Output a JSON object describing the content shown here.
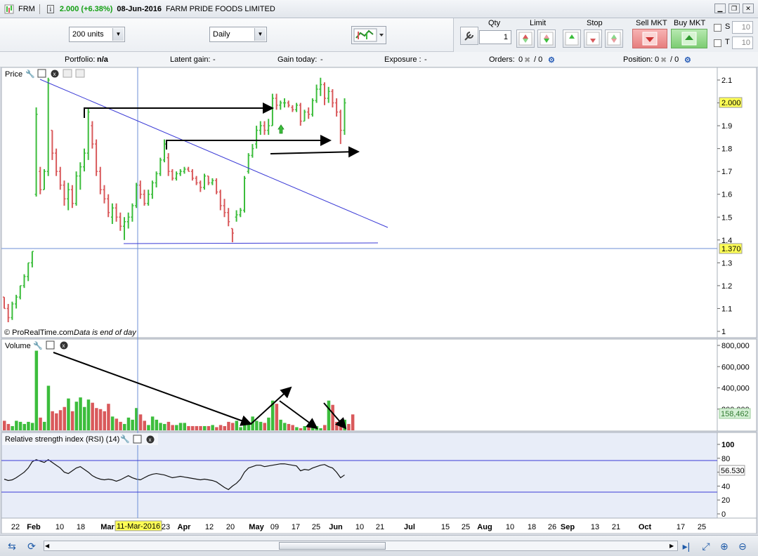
{
  "titlebar": {
    "symbol": "FRM",
    "info": "i",
    "price": "2.000 (+6.38%)",
    "date": "08-Jun-2016",
    "company": "FARM PRIDE FOODS LIMITED"
  },
  "toolbar": {
    "units": "200 units",
    "period": "Daily",
    "qty_label": "Qty",
    "qty_value": "1",
    "limit_label": "Limit",
    "stop_label": "Stop",
    "sell_label": "Sell MKT",
    "buy_label": "Buy MKT",
    "s_label": "S",
    "s_value": "10",
    "t_label": "T",
    "t_value": "10"
  },
  "infobar": {
    "portfolio_label": "Portfolio:",
    "portfolio_value": "n/a",
    "latent_label": "Latent gain:",
    "latent_value": "-",
    "gain_label": "Gain today:",
    "gain_value": "-",
    "exposure_label": "Exposure :",
    "exposure_value": "-",
    "orders_label": "Orders:",
    "orders_a": "0",
    "orders_b": "/ 0",
    "position_label": "Position:",
    "position_a": "0",
    "position_b": "/ 0"
  },
  "price_panel": {
    "title": "Price",
    "watermark": "© ProRealTime.com",
    "note": "Data is end of day",
    "current_price": "2.000",
    "crosshair_price": "1.370",
    "yticks": [
      "2.1",
      "2",
      "1.9",
      "1.8",
      "1.7",
      "1.6",
      "1.5",
      "1.4",
      "1.3",
      "1.2",
      "1.1",
      "1"
    ]
  },
  "volume_panel": {
    "title": "Volume",
    "current": "158,462",
    "yticks": [
      "800,000",
      "600,000",
      "400,000",
      "200,000"
    ]
  },
  "rsi_panel": {
    "title": "Relative strength index (RSI) (14)",
    "current": "56.530",
    "yticks": [
      "100",
      "80",
      "60",
      "40",
      "20",
      "0"
    ]
  },
  "xaxis": {
    "labels": [
      {
        "t": "22",
        "b": false
      },
      {
        "t": "Feb",
        "b": true
      },
      {
        "t": "10",
        "b": false
      },
      {
        "t": "18",
        "b": false
      },
      {
        "t": "Mar",
        "b": true
      },
      {
        "t": "23",
        "b": false
      },
      {
        "t": "Apr",
        "b": true
      },
      {
        "t": "12",
        "b": false
      },
      {
        "t": "20",
        "b": false
      },
      {
        "t": "May",
        "b": true
      },
      {
        "t": "09",
        "b": false
      },
      {
        "t": "17",
        "b": false
      },
      {
        "t": "25",
        "b": false
      },
      {
        "t": "Jun",
        "b": true
      },
      {
        "t": "10",
        "b": false
      },
      {
        "t": "21",
        "b": false
      },
      {
        "t": "Jul",
        "b": true
      },
      {
        "t": "15",
        "b": false
      },
      {
        "t": "25",
        "b": false
      },
      {
        "t": "Aug",
        "b": true
      },
      {
        "t": "10",
        "b": false
      },
      {
        "t": "18",
        "b": false
      },
      {
        "t": "26",
        "b": false
      },
      {
        "t": "Sep",
        "b": true
      },
      {
        "t": "13",
        "b": false
      },
      {
        "t": "21",
        "b": false
      },
      {
        "t": "Oct",
        "b": true
      },
      {
        "t": "17",
        "b": false
      },
      {
        "t": "25",
        "b": false
      }
    ],
    "crosshair_date": "11-Mar-2016"
  },
  "colors": {
    "up": "#3cbd3c",
    "down": "#d9595b",
    "trendline": "#3a3ad6",
    "panel_bg": "#ffffff",
    "rsi_bg": "#e8edf8",
    "current_price_bg": "#ffff55",
    "volume_label_bg": "#d6f0d6"
  },
  "chart_data": {
    "type": "ohlc",
    "title": "",
    "xlabel": "",
    "ylabel": "",
    "ylim": [
      1.0,
      2.15
    ],
    "price_bars": [
      {
        "o": 1.15,
        "h": 1.15,
        "l": 1.1,
        "c": 1.1
      },
      {
        "o": 1.1,
        "h": 1.12,
        "l": 1.04,
        "c": 1.06
      },
      {
        "o": 1.06,
        "h": 1.13,
        "l": 1.05,
        "c": 1.12
      },
      {
        "o": 1.12,
        "h": 1.16,
        "l": 1.1,
        "c": 1.15
      },
      {
        "o": 1.15,
        "h": 1.2,
        "l": 1.14,
        "c": 1.2
      },
      {
        "o": 1.2,
        "h": 1.25,
        "l": 1.19,
        "c": 1.24
      },
      {
        "o": 1.24,
        "h": 1.3,
        "l": 1.22,
        "c": 1.3
      },
      {
        "o": 1.3,
        "h": 1.35,
        "l": 1.28,
        "c": 1.35
      },
      {
        "o": 1.6,
        "h": 1.98,
        "l": 1.59,
        "c": 1.95
      },
      {
        "o": 1.7,
        "h": 1.72,
        "l": 1.6,
        "c": 1.62
      },
      {
        "o": 1.62,
        "h": 1.71,
        "l": 1.62,
        "c": 1.7
      },
      {
        "o": 1.7,
        "h": 2.11,
        "l": 1.68,
        "c": 2.1
      },
      {
        "o": 1.88,
        "h": 1.88,
        "l": 1.75,
        "c": 1.78
      },
      {
        "o": 1.78,
        "h": 1.8,
        "l": 1.68,
        "c": 1.7
      },
      {
        "o": 1.7,
        "h": 1.72,
        "l": 1.62,
        "c": 1.64
      },
      {
        "o": 1.64,
        "h": 1.66,
        "l": 1.55,
        "c": 1.58
      },
      {
        "o": 1.58,
        "h": 1.65,
        "l": 1.53,
        "c": 1.62
      },
      {
        "o": 1.62,
        "h": 1.64,
        "l": 1.54,
        "c": 1.56
      },
      {
        "o": 1.56,
        "h": 1.7,
        "l": 1.55,
        "c": 1.68
      },
      {
        "o": 1.68,
        "h": 1.74,
        "l": 1.62,
        "c": 1.72
      },
      {
        "o": 1.72,
        "h": 1.8,
        "l": 1.7,
        "c": 1.78
      },
      {
        "o": 1.78,
        "h": 1.98,
        "l": 1.75,
        "c": 1.96
      },
      {
        "o": 1.9,
        "h": 1.92,
        "l": 1.8,
        "c": 1.82
      },
      {
        "o": 1.82,
        "h": 1.84,
        "l": 1.68,
        "c": 1.7
      },
      {
        "o": 1.7,
        "h": 1.72,
        "l": 1.6,
        "c": 1.62
      },
      {
        "o": 1.62,
        "h": 1.64,
        "l": 1.56,
        "c": 1.58
      },
      {
        "o": 1.58,
        "h": 1.6,
        "l": 1.5,
        "c": 1.52
      },
      {
        "o": 1.5,
        "h": 1.56,
        "l": 1.47,
        "c": 1.54
      },
      {
        "o": 1.54,
        "h": 1.56,
        "l": 1.48,
        "c": 1.5
      },
      {
        "o": 1.5,
        "h": 1.52,
        "l": 1.44,
        "c": 1.46
      },
      {
        "o": 1.46,
        "h": 1.5,
        "l": 1.4,
        "c": 1.48
      },
      {
        "o": 1.48,
        "h": 1.52,
        "l": 1.45,
        "c": 1.5
      },
      {
        "o": 1.5,
        "h": 1.56,
        "l": 1.48,
        "c": 1.55
      },
      {
        "o": 1.55,
        "h": 1.65,
        "l": 1.54,
        "c": 1.64
      },
      {
        "o": 1.64,
        "h": 1.66,
        "l": 1.58,
        "c": 1.6
      },
      {
        "o": 1.6,
        "h": 1.62,
        "l": 1.55,
        "c": 1.56
      },
      {
        "o": 1.56,
        "h": 1.62,
        "l": 1.55,
        "c": 1.6
      },
      {
        "o": 1.6,
        "h": 1.66,
        "l": 1.58,
        "c": 1.65
      },
      {
        "o": 1.65,
        "h": 1.7,
        "l": 1.63,
        "c": 1.69
      },
      {
        "o": 1.69,
        "h": 1.76,
        "l": 1.68,
        "c": 1.75
      },
      {
        "o": 1.75,
        "h": 1.84,
        "l": 1.74,
        "c": 1.82
      },
      {
        "o": 1.76,
        "h": 1.78,
        "l": 1.68,
        "c": 1.7
      },
      {
        "o": 1.7,
        "h": 1.71,
        "l": 1.66,
        "c": 1.67
      },
      {
        "o": 1.67,
        "h": 1.7,
        "l": 1.66,
        "c": 1.69
      },
      {
        "o": 1.69,
        "h": 1.71,
        "l": 1.68,
        "c": 1.7
      },
      {
        "o": 1.7,
        "h": 1.72,
        "l": 1.69,
        "c": 1.71
      },
      {
        "o": 1.71,
        "h": 1.72,
        "l": 1.7,
        "c": 1.7
      },
      {
        "o": 1.7,
        "h": 1.71,
        "l": 1.66,
        "c": 1.67
      },
      {
        "o": 1.67,
        "h": 1.68,
        "l": 1.64,
        "c": 1.65
      },
      {
        "o": 1.65,
        "h": 1.66,
        "l": 1.61,
        "c": 1.63
      },
      {
        "o": 1.63,
        "h": 1.69,
        "l": 1.62,
        "c": 1.68
      },
      {
        "o": 1.68,
        "h": 1.68,
        "l": 1.64,
        "c": 1.65
      },
      {
        "o": 1.65,
        "h": 1.67,
        "l": 1.64,
        "c": 1.66
      },
      {
        "o": 1.66,
        "h": 1.67,
        "l": 1.6,
        "c": 1.61
      },
      {
        "o": 1.61,
        "h": 1.62,
        "l": 1.53,
        "c": 1.55
      },
      {
        "o": 1.55,
        "h": 1.58,
        "l": 1.5,
        "c": 1.52
      },
      {
        "o": 1.52,
        "h": 1.54,
        "l": 1.46,
        "c": 1.48
      },
      {
        "o": 1.45,
        "h": 1.45,
        "l": 1.39,
        "c": 1.43
      },
      {
        "o": 1.5,
        "h": 1.53,
        "l": 1.48,
        "c": 1.51
      },
      {
        "o": 1.51,
        "h": 1.54,
        "l": 1.5,
        "c": 1.53
      },
      {
        "o": 1.53,
        "h": 1.68,
        "l": 1.52,
        "c": 1.67
      },
      {
        "o": 1.7,
        "h": 1.78,
        "l": 1.69,
        "c": 1.77
      },
      {
        "o": 1.77,
        "h": 1.82,
        "l": 1.76,
        "c": 1.8
      },
      {
        "o": 1.82,
        "h": 1.9,
        "l": 1.8,
        "c": 1.88
      },
      {
        "o": 1.88,
        "h": 1.92,
        "l": 1.86,
        "c": 1.9
      },
      {
        "o": 1.9,
        "h": 1.92,
        "l": 1.86,
        "c": 1.88
      },
      {
        "o": 1.88,
        "h": 1.93,
        "l": 1.86,
        "c": 1.9
      },
      {
        "o": 1.9,
        "h": 2.04,
        "l": 1.9,
        "c": 2.02
      },
      {
        "o": 2.02,
        "h": 2.04,
        "l": 1.97,
        "c": 1.99
      },
      {
        "o": 1.99,
        "h": 2.01,
        "l": 1.97,
        "c": 2.0
      },
      {
        "o": 2.0,
        "h": 2.02,
        "l": 1.98,
        "c": 2.0
      },
      {
        "o": 2.0,
        "h": 2.01,
        "l": 1.98,
        "c": 1.99
      },
      {
        "o": 1.98,
        "h": 1.99,
        "l": 1.96,
        "c": 1.97
      },
      {
        "o": 1.97,
        "h": 2.0,
        "l": 1.96,
        "c": 1.99
      },
      {
        "o": 1.99,
        "h": 2.0,
        "l": 1.9,
        "c": 1.92
      },
      {
        "o": 1.92,
        "h": 1.97,
        "l": 1.92,
        "c": 1.96
      },
      {
        "o": 1.96,
        "h": 1.98,
        "l": 1.93,
        "c": 1.95
      },
      {
        "o": 1.95,
        "h": 2.02,
        "l": 1.94,
        "c": 2.01
      },
      {
        "o": 2.01,
        "h": 2.08,
        "l": 2.0,
        "c": 2.06
      },
      {
        "o": 2.06,
        "h": 2.11,
        "l": 2.03,
        "c": 2.08
      },
      {
        "o": 2.08,
        "h": 2.09,
        "l": 1.99,
        "c": 2.02
      },
      {
        "o": 2.02,
        "h": 2.07,
        "l": 2.0,
        "c": 2.05
      },
      {
        "o": 2.05,
        "h": 2.06,
        "l": 1.98,
        "c": 2.0
      },
      {
        "o": 2.0,
        "h": 2.02,
        "l": 1.94,
        "c": 1.96
      },
      {
        "o": 1.96,
        "h": 1.97,
        "l": 1.82,
        "c": 1.88
      },
      {
        "o": 1.88,
        "h": 2.02,
        "l": 1.86,
        "c": 2.0
      }
    ],
    "volume": [
      90000,
      60000,
      40000,
      90000,
      80000,
      60000,
      80000,
      70000,
      750000,
      120000,
      80000,
      420000,
      180000,
      160000,
      190000,
      220000,
      300000,
      180000,
      270000,
      310000,
      220000,
      290000,
      260000,
      210000,
      200000,
      180000,
      250000,
      130000,
      110000,
      80000,
      60000,
      120000,
      100000,
      210000,
      150000,
      90000,
      50000,
      130000,
      100000,
      70000,
      60000,
      80000,
      50000,
      50000,
      70000,
      70000,
      40000,
      40000,
      40000,
      40000,
      40000,
      40000,
      50000,
      30000,
      50000,
      40000,
      80000,
      70000,
      90000,
      30000,
      110000,
      80000,
      130000,
      90000,
      80000,
      70000,
      120000,
      280000,
      250000,
      100000,
      70000,
      60000,
      50000,
      30000,
      20000,
      40000,
      50000,
      60000,
      40000,
      20000,
      50000,
      280000,
      240000,
      80000,
      60000,
      100000,
      60000,
      150000
    ],
    "rsi": [
      50,
      48,
      49,
      52,
      56,
      60,
      66,
      75,
      78,
      76,
      74,
      78,
      74,
      70,
      66,
      60,
      58,
      62,
      66,
      68,
      64,
      60,
      55,
      52,
      50,
      49,
      50,
      49,
      47,
      49,
      52,
      55,
      52,
      50,
      49,
      52,
      55,
      57,
      58,
      57,
      56,
      54,
      52,
      53,
      54,
      53,
      52,
      51,
      50,
      49,
      50,
      49,
      48,
      46,
      42,
      38,
      35,
      40,
      44,
      50,
      60,
      66,
      68,
      70,
      70,
      68,
      69,
      70,
      71,
      72,
      72,
      71,
      70,
      69,
      62,
      64,
      63,
      66,
      68,
      70,
      71,
      68,
      66,
      60,
      52,
      56
    ],
    "rsi_levels": [
      70,
      30
    ]
  }
}
